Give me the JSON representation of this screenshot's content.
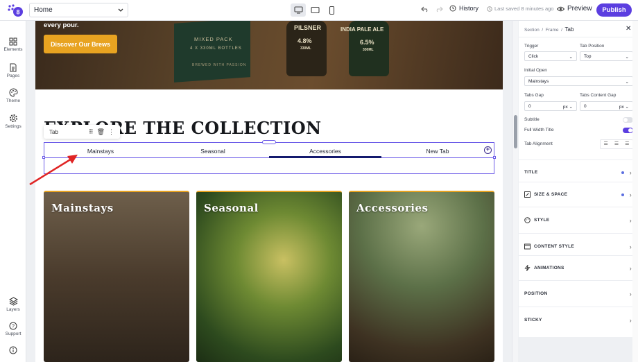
{
  "topbar": {
    "page_select": "Home",
    "history_label": "History",
    "saved_label": "Last saved 8 minutes ago",
    "preview_label": "Preview",
    "publish_label": "Publish"
  },
  "sidebar": {
    "items": [
      {
        "label": "Elements",
        "icon": "grid-icon"
      },
      {
        "label": "Pages",
        "icon": "page-icon"
      },
      {
        "label": "Theme",
        "icon": "palette-icon"
      },
      {
        "label": "Settings",
        "icon": "gear-icon"
      },
      {
        "label": "Layers",
        "icon": "layers-icon"
      },
      {
        "label": "Support",
        "icon": "help-icon"
      },
      {
        "label": "",
        "icon": "info-icon"
      }
    ]
  },
  "canvas": {
    "hero_text": "every pour.",
    "hero_button": "Discover Our Brews",
    "box_lines": [
      "MIXED PACK",
      "4 X 330ML BOTTLES",
      "BREWED WITH PASSION"
    ],
    "bottle1": {
      "name": "PILSNER",
      "abv": "4.8%",
      "vol": "330ML"
    },
    "bottle2": {
      "name": "INDIA PALE ALE",
      "abv": "6.5%",
      "vol": "330ML"
    },
    "section_title": "EXPLORE THE COLLECTION",
    "tab_toolbar_label": "Tab",
    "tabs": [
      "Mainstays",
      "Seasonal",
      "Accessories",
      "New Tab"
    ],
    "active_tab": "Accessories",
    "cards": [
      "Mainstays",
      "Seasonal",
      "Accessories"
    ]
  },
  "panel": {
    "breadcrumb": {
      "a": "Section",
      "b": "Frame",
      "c": "Tab"
    },
    "trigger": {
      "label": "Trigger",
      "value": "Click"
    },
    "tab_position": {
      "label": "Tab Position",
      "value": "Top"
    },
    "initial_open": {
      "label": "Initial Open",
      "value": "Mainstays"
    },
    "tabs_gap": {
      "label": "Tabs Gap",
      "value": "0",
      "unit": "px"
    },
    "tabs_content_gap": {
      "label": "Tabs Content Gap",
      "value": "0",
      "unit": "px"
    },
    "subtitle_label": "Subtitle",
    "full_width_title_label": "Full Width Title",
    "tab_alignment_label": "Tab Alignment",
    "sections": [
      "TITLE",
      "SIZE & SPACE",
      "STYLE",
      "CONTENT STYLE",
      "ANIMATIONS",
      "POSITION",
      "STICKY"
    ]
  },
  "colors": {
    "accent": "#5b3ee0",
    "brand_orange": "#e8a321",
    "tab_active": "#141a6e",
    "selection": "#6b5ae8"
  }
}
